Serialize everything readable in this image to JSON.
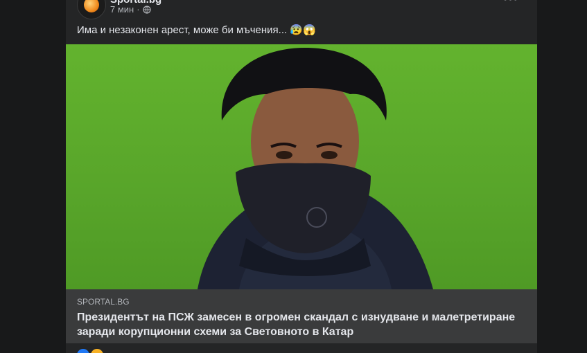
{
  "post": {
    "author": "Sportal.bg",
    "time": "7 мин",
    "separator": "·",
    "text": "Има и незаконен арест, може би мъчения... 😰😱",
    "more_label": "•••"
  },
  "link": {
    "domain": "SPORTAL.BG",
    "headline": "Президентът на ПСЖ замесен в огромен скандал с изнудване и малетретиране заради корупционни схеми за Световното в Катар"
  },
  "icons": {
    "avatar": "sportal-logo",
    "privacy": "globe-icon",
    "menu": "more-icon"
  },
  "colors": {
    "background": "#18191a",
    "card": "#242526",
    "preview": "#3a3b3c",
    "text": "#e4e6eb",
    "secondary": "#b0b3b8"
  }
}
